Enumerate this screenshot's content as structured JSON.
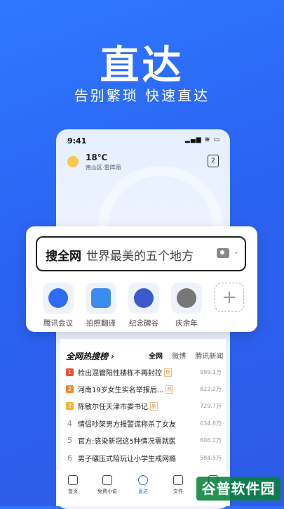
{
  "promo": {
    "headline": "直达",
    "subline": "告别繁琐 快速直达"
  },
  "phone": {
    "status_time": "9:41",
    "status_icons": "▂▄▆ ≋ ▭",
    "weather": {
      "temp": "18℃",
      "location": "南山区·雷阵雨",
      "icon": "sun-icon"
    },
    "tab_count": "2"
  },
  "search": {
    "brand": "搜全网",
    "query": "世界最美的五个地方",
    "chevron": "⌄"
  },
  "apps": [
    {
      "label": "腾讯会议",
      "icon": "tencent-meeting-icon",
      "color": "#2f6cf6"
    },
    {
      "label": "拍照翻译",
      "icon": "photo-translate-icon",
      "color": "#3b8cf0"
    },
    {
      "label": "纪念碑谷",
      "icon": "monument-valley-icon",
      "color": "#3a5bc9"
    },
    {
      "label": "庆余年",
      "icon": "qingyunian-icon",
      "color": "#777"
    }
  ],
  "add_label": "+",
  "hot": {
    "title": "全网热搜榜 ›",
    "tabs": [
      "全网",
      "微博",
      "腾讯新闻"
    ],
    "items": [
      {
        "rank": "1",
        "title": "检出混管阳性楼栋不再封控",
        "tag": "热",
        "count": "999.1万",
        "color": "#e8513a"
      },
      {
        "rank": "2",
        "title": "河南19岁女生实名举报后...",
        "tag": "热",
        "count": "822.2万",
        "color": "#ef8a2d"
      },
      {
        "rank": "3",
        "title": "陈敏尔任天津市委书记",
        "tag": "新",
        "count": "729.7万",
        "color": "#f2b534"
      },
      {
        "rank": "4",
        "title": "情侣吵架男方报警谎称杀了女友",
        "tag": "",
        "count": "634.8万",
        "color": ""
      },
      {
        "rank": "5",
        "title": "官方:感染新冠这5种情况需就医",
        "tag": "",
        "count": "606.2万",
        "color": ""
      },
      {
        "rank": "6",
        "title": "男子碾压式陪玩让小学生戒网瘾",
        "tag": "",
        "count": "584.5万",
        "color": ""
      }
    ]
  },
  "nav": [
    {
      "label": "首页",
      "icon": "home-icon"
    },
    {
      "label": "免费小说",
      "icon": "book-icon"
    },
    {
      "label": "直达",
      "icon": "direct-icon"
    },
    {
      "label": "文件",
      "icon": "file-icon"
    },
    {
      "label": "",
      "icon": "profile-icon"
    }
  ],
  "watermark": "谷普软件园"
}
